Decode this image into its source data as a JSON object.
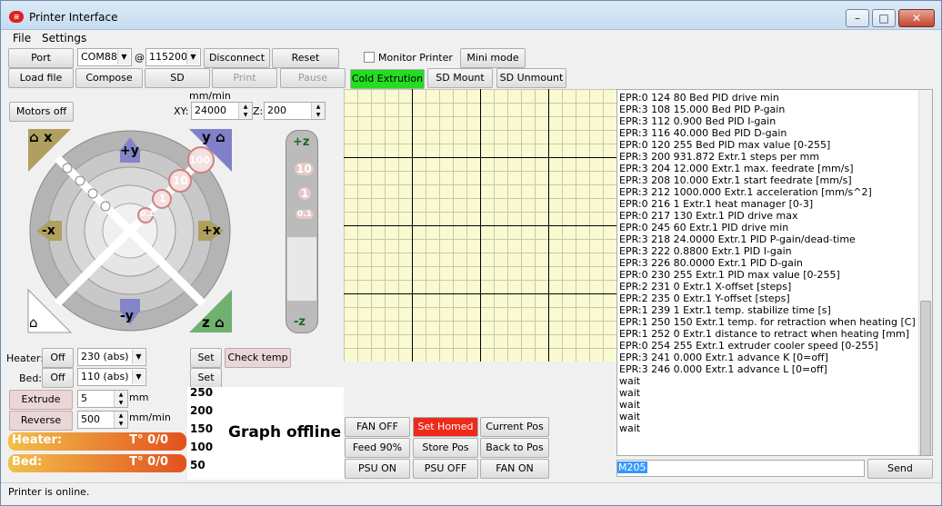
{
  "window": {
    "title": "Printer Interface"
  },
  "menu": [
    "File",
    "Settings"
  ],
  "toolbar1": {
    "port": "Port",
    "com": "COM88",
    "at": "@",
    "baud": "115200",
    "disconnect": "Disconnect",
    "reset": "Reset",
    "monitor": "Monitor Printer",
    "mini": "Mini mode"
  },
  "toolbar2": {
    "load": "Load file",
    "compose": "Compose",
    "sd": "SD",
    "print": "Print",
    "pause": "Pause",
    "cold": "Cold Extrution",
    "sdmount": "SD Mount",
    "sdunmount": "SD Unmount"
  },
  "motors_off": "Motors off",
  "feed": {
    "unit": "mm/min",
    "xy_label": "XY:",
    "xy": "24000",
    "z_label": "Z:",
    "z": "200"
  },
  "jog": {
    "x_home": "x",
    "y_home": "y",
    "z_home": "z",
    "minus_x": "-x",
    "plus_x": "+x",
    "plus_y": "+y",
    "minus_y": "-y",
    "plus_z": "+z",
    "minus_z": "-z",
    "s100": "100",
    "s10": "10",
    "s1": "1",
    "s01": "0.1",
    "z10": "10",
    "z1": "1",
    "z01": "0.1"
  },
  "heater": {
    "label": "Heater:",
    "off": "Off",
    "value": "230 (abs)",
    "set": "Set",
    "check": "Check temp"
  },
  "bed": {
    "label": "Bed:",
    "off": "Off",
    "value": "110 (abs)",
    "set": "Set"
  },
  "extrude": {
    "label": "Extrude",
    "value": "5",
    "unit": "mm"
  },
  "reverse": {
    "label": "Reverse",
    "value": "500",
    "unit": "mm/min"
  },
  "temps": {
    "heater_label": "Heater:",
    "heater_val": "T° 0/0",
    "bed_label": "Bed:",
    "bed_val": "T° 0/0"
  },
  "graph": {
    "ticks": [
      "250",
      "200",
      "150",
      "100",
      "50"
    ],
    "offline": "Graph offline"
  },
  "macros": [
    [
      "FAN OFF",
      "Set Homed",
      "Current Pos"
    ],
    [
      "Feed 90%",
      "Store Pos",
      "Back to Pos"
    ],
    [
      "PSU ON",
      "PSU OFF",
      "FAN ON"
    ]
  ],
  "log": [
    "EPR:0 124 80 Bed PID drive min",
    "EPR:3 108 15.000 Bed PID P-gain",
    "EPR:3 112 0.900 Bed PID I-gain",
    "EPR:3 116 40.000 Bed PID D-gain",
    "EPR:0 120 255 Bed PID max value [0-255]",
    "EPR:3 200 931.872 Extr.1 steps per mm",
    "EPR:3 204 12.000 Extr.1 max. feedrate [mm/s]",
    "EPR:3 208 10.000 Extr.1 start feedrate [mm/s]",
    "EPR:3 212 1000.000 Extr.1 acceleration [mm/s^2]",
    "EPR:0 216 1 Extr.1 heat manager [0-3]",
    "EPR:0 217 130 Extr.1 PID drive max",
    "EPR:0 245 60 Extr.1 PID drive min",
    "EPR:3 218 24.0000 Extr.1 PID P-gain/dead-time",
    "EPR:3 222 0.8800 Extr.1 PID I-gain",
    "EPR:3 226 80.0000 Extr.1 PID D-gain",
    "EPR:0 230 255 Extr.1 PID max value [0-255]",
    "EPR:2 231 0 Extr.1 X-offset [steps]",
    "EPR:2 235 0 Extr.1 Y-offset [steps]",
    "EPR:1 239 1 Extr.1 temp. stabilize time [s]",
    "EPR:1 250 150 Extr.1 temp. for retraction when heating [C]",
    "EPR:1 252 0 Extr.1 distance to retract when heating [mm]",
    "EPR:0 254 255 Extr.1 extruder cooler speed [0-255]",
    "EPR:3 241 0.000 Extr.1 advance K [0=off]",
    "EPR:3 246 0.000 Extr.1 advance L [0=off]",
    "wait",
    "wait",
    "wait",
    "wait",
    "wait"
  ],
  "command": {
    "value": "M205",
    "send": "Send"
  },
  "status": "Printer is online.",
  "colors": {
    "cold_green": "#22dd22",
    "homed_red": "#ee2a1a"
  }
}
